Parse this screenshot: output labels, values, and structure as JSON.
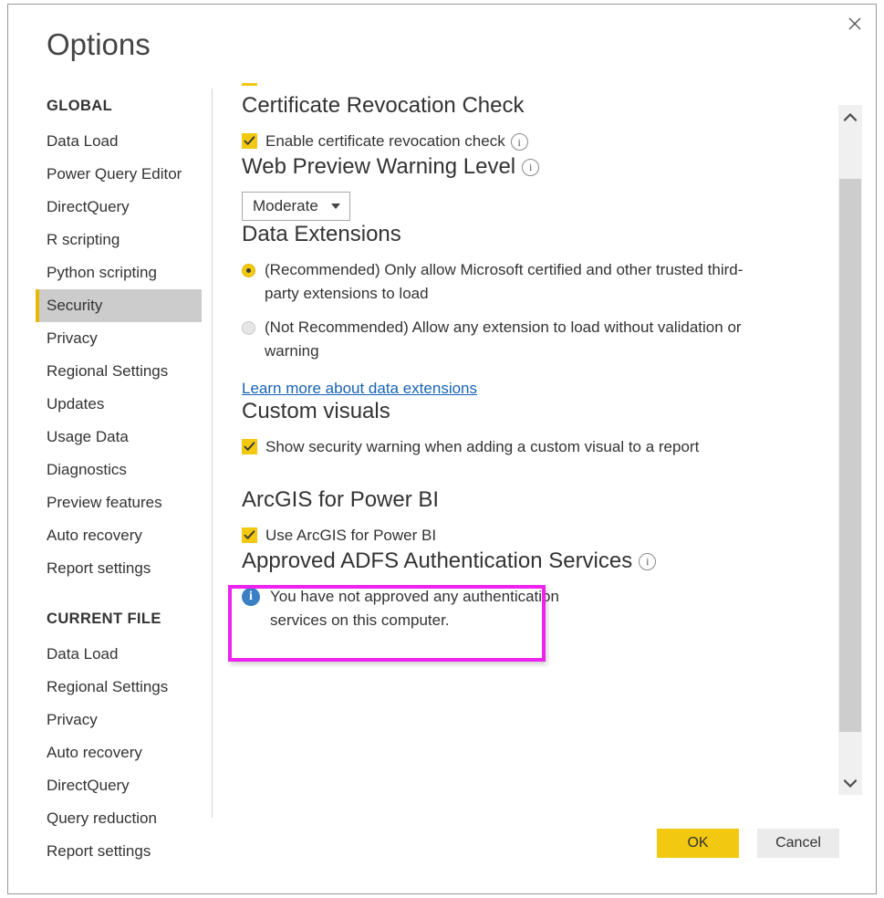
{
  "window": {
    "title": "Options",
    "close_icon": "close-icon"
  },
  "nav": {
    "groups": [
      {
        "title": "GLOBAL",
        "items": [
          {
            "label": "Data Load",
            "selected": false
          },
          {
            "label": "Power Query Editor",
            "selected": false
          },
          {
            "label": "DirectQuery",
            "selected": false
          },
          {
            "label": "R scripting",
            "selected": false
          },
          {
            "label": "Python scripting",
            "selected": false
          },
          {
            "label": "Security",
            "selected": true
          },
          {
            "label": "Privacy",
            "selected": false
          },
          {
            "label": "Regional Settings",
            "selected": false
          },
          {
            "label": "Updates",
            "selected": false
          },
          {
            "label": "Usage Data",
            "selected": false
          },
          {
            "label": "Diagnostics",
            "selected": false
          },
          {
            "label": "Preview features",
            "selected": false
          },
          {
            "label": "Auto recovery",
            "selected": false
          },
          {
            "label": "Report settings",
            "selected": false
          }
        ]
      },
      {
        "title": "CURRENT FILE",
        "items": [
          {
            "label": "Data Load",
            "selected": false
          },
          {
            "label": "Regional Settings",
            "selected": false
          },
          {
            "label": "Privacy",
            "selected": false
          },
          {
            "label": "Auto recovery",
            "selected": false
          },
          {
            "label": "DirectQuery",
            "selected": false
          },
          {
            "label": "Query reduction",
            "selected": false
          },
          {
            "label": "Report settings",
            "selected": false
          }
        ]
      }
    ]
  },
  "content": {
    "certificate": {
      "heading": "Certificate Revocation Check",
      "checkbox_label": "Enable certificate revocation check",
      "checkbox_checked": "true",
      "info_icon": "info-icon"
    },
    "web_preview": {
      "heading": "Web Preview Warning Level",
      "info_icon": "info-icon",
      "dropdown_value": "Moderate"
    },
    "data_extensions": {
      "heading": "Data Extensions",
      "options": [
        {
          "label": "(Recommended) Only allow Microsoft certified and other trusted third-party extensions to load",
          "selected": "true"
        },
        {
          "label": "(Not Recommended) Allow any extension to load without validation or warning",
          "selected": "false"
        }
      ],
      "link_label": "Learn more about data extensions"
    },
    "custom_visuals": {
      "heading": "Custom visuals",
      "checkbox_label": "Show security warning when adding a custom visual to a report",
      "checkbox_checked": "true"
    },
    "arcgis": {
      "heading": "ArcGIS for Power BI",
      "checkbox_label": "Use ArcGIS for Power BI",
      "checkbox_checked": "true",
      "highlight_color": "#ee22ee"
    },
    "adfs": {
      "heading": "Approved ADFS Authentication Services",
      "info_icon": "info-icon",
      "message_line1": "You have not approved any authentication",
      "message_line2": "services on this computer."
    }
  },
  "scrollbar": {
    "up_icon": "chevron-up-icon",
    "down_icon": "chevron-down-icon"
  },
  "footer": {
    "ok_label": "OK",
    "cancel_label": "Cancel"
  },
  "colors": {
    "accent_yellow": "#f2c811",
    "highlight_magenta": "#ee22ee",
    "link_blue": "#1763b5",
    "info_blue": "#3b7fc4"
  }
}
